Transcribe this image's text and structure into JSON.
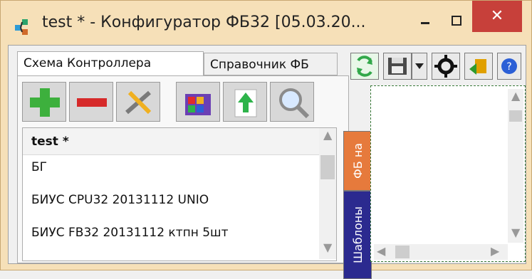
{
  "window": {
    "title": "test * - Конфигуратор ФБ32 [05.03.20..."
  },
  "tabs": [
    {
      "label": "Схема Контроллера"
    },
    {
      "label": "Справочник ФБ"
    }
  ],
  "toolbar_right": {
    "icons": [
      "refresh-icon",
      "save-icon",
      "save-dropdown-icon",
      "settings-icon",
      "export-icon",
      "help-icon"
    ]
  },
  "toolbar_main": {
    "icons": [
      "add-icon",
      "remove-icon",
      "tools-icon",
      "controller-icon",
      "upload-icon",
      "search-icon"
    ]
  },
  "tree": {
    "header": "test *",
    "items": [
      "БГ",
      "БИУС CPU32 20131112 UNIO",
      "БИУС FB32 20131112 ктпн 5шт"
    ]
  },
  "side_tabs": {
    "fb_label": "ФБ на",
    "templates_label": "Шаблоны"
  },
  "colors": {
    "title_bg": "#f6e0b8",
    "close_bg": "#c7403a",
    "tab_fb": "#e67a3c",
    "tab_templates": "#2b2a8f"
  }
}
